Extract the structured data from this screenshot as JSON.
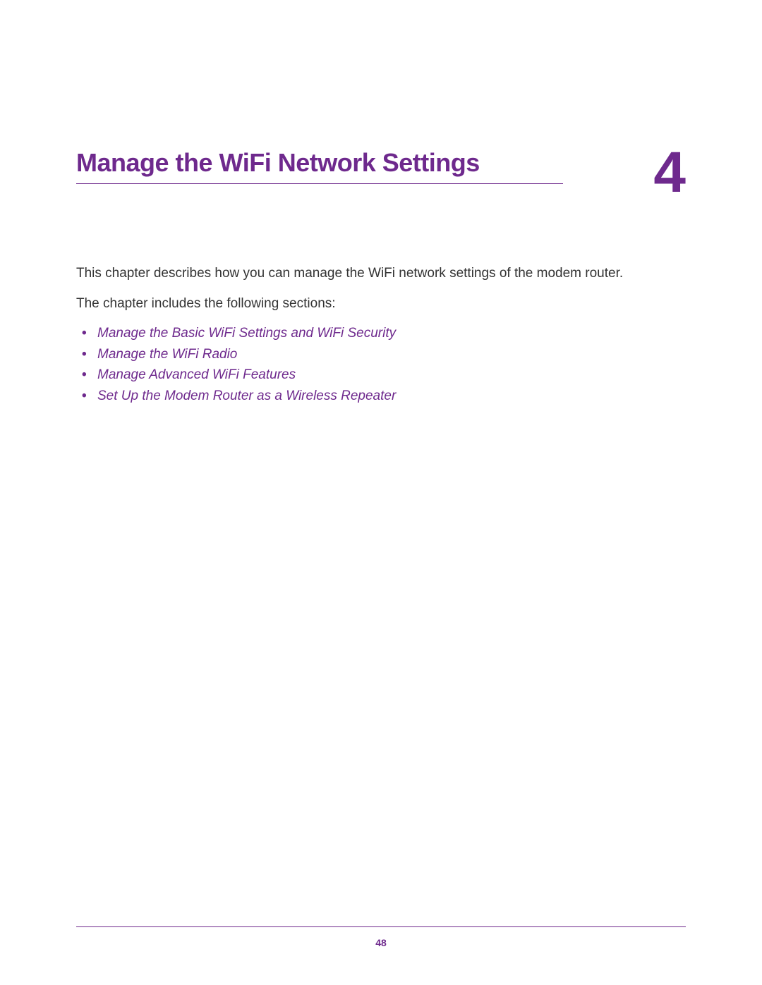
{
  "chapter": {
    "title": "Manage the WiFi Network Settings",
    "number": "4"
  },
  "content": {
    "intro": "This chapter describes how you can manage the WiFi network settings of the modem router.",
    "sections_intro": "The chapter includes the following sections:",
    "sections": [
      "Manage the Basic WiFi Settings and WiFi Security",
      "Manage the WiFi Radio",
      "Manage Advanced WiFi Features",
      "Set Up the Modem Router as a Wireless Repeater"
    ]
  },
  "footer": {
    "page_number": "48"
  }
}
